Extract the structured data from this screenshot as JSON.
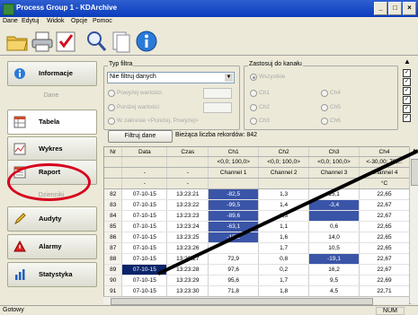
{
  "window": {
    "title": "Process Group 1 - KDArchive",
    "buttons": [
      "_",
      "□",
      "×"
    ]
  },
  "menu": [
    "Dane",
    "Edytuj",
    "Widok",
    "Opcje",
    "Pomoc"
  ],
  "toolbar": {
    "icons": [
      "open-folder-icon",
      "print-icon",
      "check-icon",
      "search-icon",
      "document-icon",
      "info-icon"
    ]
  },
  "nav": {
    "items": [
      {
        "label": "Informacje",
        "icon": "info-icon"
      },
      {
        "label": "Tabela",
        "icon": "table-icon"
      },
      {
        "label": "Wykres",
        "icon": "chart-icon"
      },
      {
        "label": "Raport",
        "icon": "report-icon"
      },
      {
        "label": "Audyty",
        "icon": "pencil-icon"
      },
      {
        "label": "Alarmy",
        "icon": "alarm-icon"
      },
      {
        "label": "Statystyka",
        "icon": "stats-icon"
      }
    ],
    "section_dane": "Dane",
    "section_dzienniki": "Dzienniki"
  },
  "filter": {
    "group_label": "Typ filtra",
    "select_value": "Nie filtruj danych",
    "options": [
      "Powyżej wartości",
      "Poniżej wartości",
      "W zakresie <Poniżej, Powyżej>"
    ],
    "button": "Filtruj dane",
    "count_label": "Bieżąca liczba rekordów: 842"
  },
  "channels": {
    "group_label": "Zastosuj do kanału",
    "all": "Wszystkie",
    "list": [
      "Ch1",
      "Ch2",
      "Ch3",
      "Ch4",
      "Ch5",
      "Ch6"
    ]
  },
  "table": {
    "headers": [
      "Nr",
      "Data",
      "Czas",
      "Ch1\n<0,0; 100,0>",
      "Ch2\n<0,0; 100,0>",
      "Ch3\n<0,0; 100,0>",
      "Ch4\n<-30,00; 70,..."
    ],
    "header_top": [
      "Nr",
      "Data",
      "Czas",
      "Ch1",
      "Ch2",
      "Ch3",
      "Ch4"
    ],
    "header_range": [
      "",
      "",
      "",
      "<0,0; 100,0>",
      "<0,0; 100,0>",
      "<0,0; 100,0>",
      "<-30,00; 70,..."
    ],
    "header_channel": [
      "",
      "-",
      "-",
      "Channel 1",
      "Channel 2",
      "Channel 3",
      "Channel 4"
    ],
    "header_unit": [
      "",
      "-",
      "-",
      "",
      "",
      "",
      "°C"
    ],
    "rows": [
      [
        "82",
        "07-10-15",
        "13:23:21",
        "-82,5",
        "1,3",
        "15,1",
        "22,65"
      ],
      [
        "83",
        "07-10-15",
        "13:23:22",
        "-99,5",
        "1,4",
        "-3,4",
        "22,67"
      ],
      [
        "84",
        "07-10-15",
        "13:23:23",
        "-89,6",
        "1,3",
        "",
        "22,67"
      ],
      [
        "85",
        "07-10-15",
        "13:23:24",
        "-63,1",
        "1,1",
        "0,6",
        "22,65"
      ],
      [
        "86",
        "07-10-15",
        "13:23:25",
        "-15,2",
        "1,6",
        "14,0",
        "22,65"
      ],
      [
        "87",
        "07-10-15",
        "13:23:26",
        "",
        "1,7",
        "10,5",
        "22,65"
      ],
      [
        "88",
        "07-10-15",
        "13:23:27",
        "72,9",
        "0,8",
        "-19,1",
        "22,67"
      ],
      [
        "89",
        "07-10-15",
        "13:23:28",
        "97,6",
        "0,2",
        "16,2",
        "22,67"
      ],
      [
        "90",
        "07-10-15",
        "13:23:29",
        "95,6",
        "1,7",
        "9,5",
        "22,69"
      ],
      [
        "91",
        "07-10-15",
        "13:23:30",
        "71,8",
        "1,8",
        "4,5",
        "22,71"
      ]
    ]
  },
  "status": {
    "left": "Gotowy",
    "right": "NUM"
  }
}
